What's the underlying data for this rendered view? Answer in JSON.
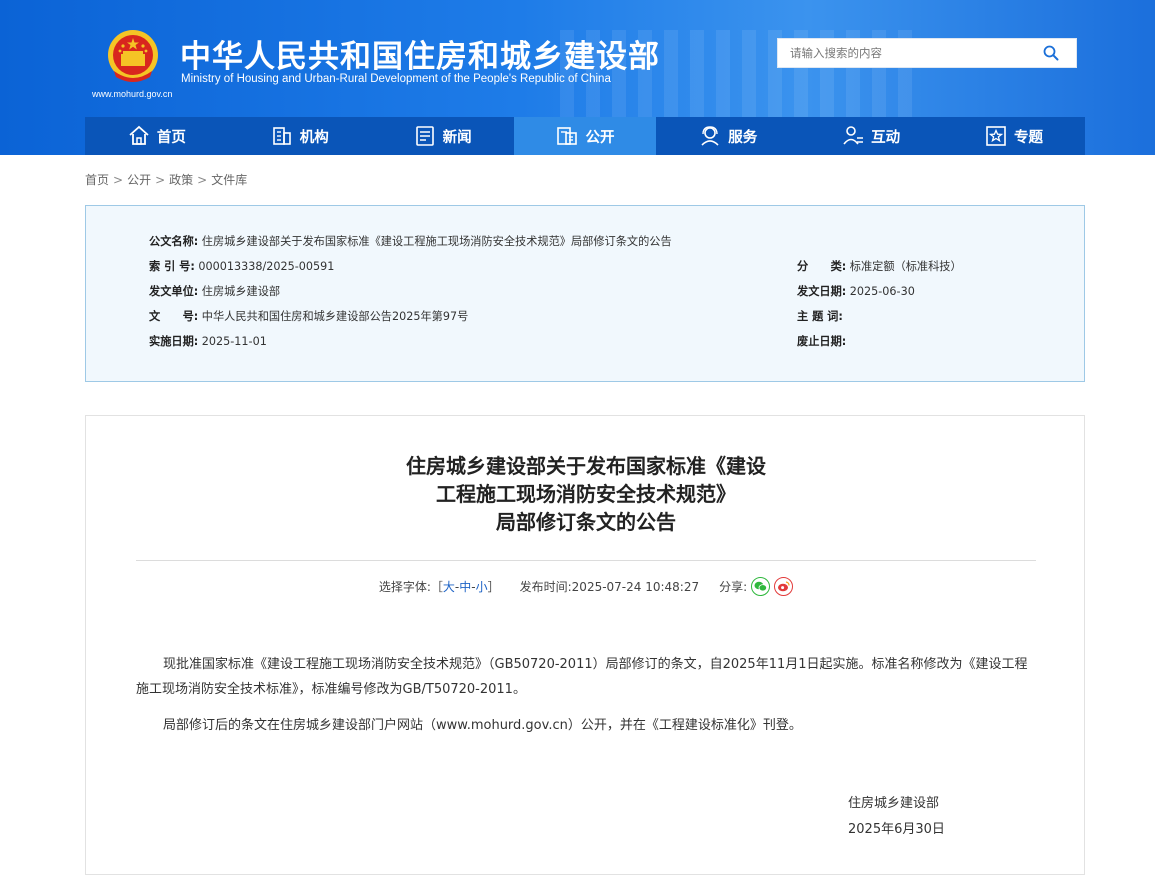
{
  "header": {
    "title": "中华人民共和国住房和城乡建设部",
    "title_en": "Ministry of Housing and Urban-Rural Development of the People's Republic of China",
    "site_url": "www.mohurd.gov.cn",
    "search_placeholder": "请输入搜索的内容"
  },
  "nav": [
    {
      "label": "首页",
      "icon": "home-icon"
    },
    {
      "label": "机构",
      "icon": "building-icon"
    },
    {
      "label": "新闻",
      "icon": "news-icon"
    },
    {
      "label": "公开",
      "icon": "disclosure-icon",
      "active": true
    },
    {
      "label": "服务",
      "icon": "service-icon"
    },
    {
      "label": "互动",
      "icon": "interaction-icon"
    },
    {
      "label": "专题",
      "icon": "topic-icon"
    }
  ],
  "breadcrumb": [
    "首页",
    "公开",
    "政策",
    "文件库"
  ],
  "breadcrumb_sep": ">",
  "info": {
    "doc_name_label": "公文名称:",
    "doc_name": "住房城乡建设部关于发布国家标准《建设工程施工现场消防安全技术规范》局部修订条文的公告",
    "index_label": "索 引 号:",
    "index": "000013338/2025-00591",
    "category_label": "分　　类:",
    "category": "标准定额（标准科技）",
    "issuer_label": "发文单位:",
    "issuer": "住房城乡建设部",
    "issue_date_label": "发文日期:",
    "issue_date": "2025-06-30",
    "doc_no_label": "文　　号:",
    "doc_no": "中华人民共和国住房和城乡建设部公告2025年第97号",
    "subject_label": "主 题 词:",
    "subject": "",
    "effective_label": "实施日期:",
    "effective": "2025-11-01",
    "abolish_label": "废止日期:",
    "abolish": ""
  },
  "article": {
    "title_lines": [
      "住房城乡建设部关于发布国家标准《建设",
      "工程施工现场消防安全技术规范》",
      "局部修订条文的公告"
    ],
    "font_size_label": "选择字体:",
    "font_size_open": "［",
    "font_size_options": [
      "大",
      "中",
      "小"
    ],
    "font_size_dash": "-",
    "font_size_close": "］",
    "publish_label": "发布时间:",
    "publish_time": "2025-07-24 10:48:27",
    "share_label": "分享:",
    "paragraphs": [
      "现批准国家标准《建设工程施工现场消防安全技术规范》（GB50720-2011）局部修订的条文，自2025年11月1日起实施。标准名称修改为《建设工程施工现场消防安全技术标准》，标准编号修改为GB/T50720-2011。",
      "局部修订后的条文在住房城乡建设部门户网站（www.mohurd.gov.cn）公开，并在《工程建设标准化》刊登。"
    ],
    "signature": "住房城乡建设部",
    "sign_date": "2025年6月30日"
  },
  "colors": {
    "header_blue": "#1a72e0",
    "nav_bg": "#0a55b8",
    "nav_active": "#2f8be6",
    "link_blue": "#1d63c6",
    "info_bg": "#f1f8fd"
  }
}
